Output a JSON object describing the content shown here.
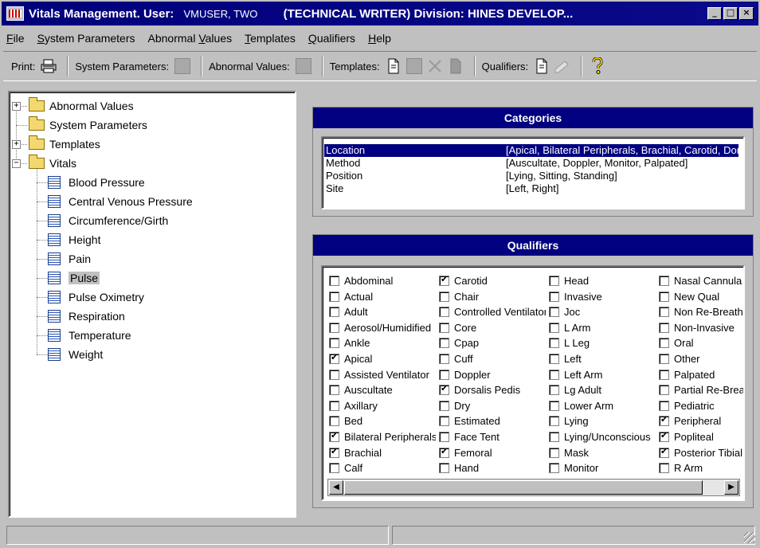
{
  "window": {
    "app": "Vitals Management.",
    "user_label": "User:",
    "user": "VMUSER, TWO",
    "division": "(TECHNICAL WRITER) Division: HINES DEVELOP..."
  },
  "menu": [
    {
      "pre": "",
      "u": "F",
      "post": "ile"
    },
    {
      "pre": "",
      "u": "S",
      "post": "ystem Parameters"
    },
    {
      "pre": "Abnormal ",
      "u": "V",
      "post": "alues"
    },
    {
      "pre": "",
      "u": "T",
      "post": "emplates"
    },
    {
      "pre": "",
      "u": "Q",
      "post": "ualifiers"
    },
    {
      "pre": "",
      "u": "H",
      "post": "elp"
    }
  ],
  "toolbar": {
    "print": "Print:",
    "system_parameters": "System Parameters:",
    "abnormal_values": "Abnormal Values:",
    "templates": "Templates:",
    "qualifiers": "Qualifiers:"
  },
  "tree": {
    "roots": [
      "Abnormal Values",
      "System Parameters",
      "Templates",
      "Vitals"
    ],
    "vitals": [
      "Blood Pressure",
      "Central Venous Pressure",
      "Circumference/Girth",
      "Height",
      "Pain",
      "Pulse",
      "Pulse Oximetry",
      "Respiration",
      "Temperature",
      "Weight"
    ],
    "selected": "Pulse"
  },
  "categories": {
    "title": "Categories",
    "rows": [
      {
        "name": "Location",
        "values": "[Apical, Bilateral Peripherals, Brachial, Carotid, Dorsalis Pedis"
      },
      {
        "name": "Method",
        "values": "[Auscultate, Doppler, Monitor, Palpated]"
      },
      {
        "name": "Position",
        "values": "[Lying, Sitting, Standing]"
      },
      {
        "name": "Site",
        "values": "[Left, Right]"
      }
    ],
    "selected": "Location"
  },
  "qualifiers": {
    "title": "Qualifiers",
    "columns": [
      [
        {
          "label": "Abdominal",
          "checked": false
        },
        {
          "label": "Actual",
          "checked": false
        },
        {
          "label": "Adult",
          "checked": false
        },
        {
          "label": "Aerosol/Humidified",
          "checked": false
        },
        {
          "label": "Ankle",
          "checked": false
        },
        {
          "label": "Apical",
          "checked": true
        },
        {
          "label": "Assisted Ventilator",
          "checked": false
        },
        {
          "label": "Auscultate",
          "checked": false
        },
        {
          "label": "Axillary",
          "checked": false
        },
        {
          "label": "Bed",
          "checked": false
        },
        {
          "label": "Bilateral Peripherals",
          "checked": true
        },
        {
          "label": "Brachial",
          "checked": true
        },
        {
          "label": "Calf",
          "checked": false
        }
      ],
      [
        {
          "label": "Carotid",
          "checked": true
        },
        {
          "label": "Chair",
          "checked": false
        },
        {
          "label": "Controlled Ventilator",
          "checked": false
        },
        {
          "label": "Core",
          "checked": false
        },
        {
          "label": "Cpap",
          "checked": false
        },
        {
          "label": "Cuff",
          "checked": false
        },
        {
          "label": "Doppler",
          "checked": false
        },
        {
          "label": "Dorsalis Pedis",
          "checked": true
        },
        {
          "label": "Dry",
          "checked": false
        },
        {
          "label": "Estimated",
          "checked": false
        },
        {
          "label": "Face Tent",
          "checked": false
        },
        {
          "label": "Femoral",
          "checked": true
        },
        {
          "label": "Hand",
          "checked": false
        }
      ],
      [
        {
          "label": "Head",
          "checked": false
        },
        {
          "label": "Invasive",
          "checked": false
        },
        {
          "label": "Joc",
          "checked": false
        },
        {
          "label": "L Arm",
          "checked": false
        },
        {
          "label": "L Leg",
          "checked": false
        },
        {
          "label": "Left",
          "checked": false
        },
        {
          "label": "Left Arm",
          "checked": false
        },
        {
          "label": "Lg Adult",
          "checked": false
        },
        {
          "label": "Lower Arm",
          "checked": false
        },
        {
          "label": "Lying",
          "checked": false
        },
        {
          "label": "Lying/Unconscious",
          "checked": false
        },
        {
          "label": "Mask",
          "checked": false
        },
        {
          "label": "Monitor",
          "checked": false
        }
      ],
      [
        {
          "label": "Nasal Cannula",
          "checked": false
        },
        {
          "label": "New Qual",
          "checked": false
        },
        {
          "label": "Non Re-Breathing",
          "checked": false
        },
        {
          "label": "Non-Invasive",
          "checked": false
        },
        {
          "label": "Oral",
          "checked": false
        },
        {
          "label": "Other",
          "checked": false
        },
        {
          "label": "Palpated",
          "checked": false
        },
        {
          "label": "Partial Re-Breathing",
          "checked": false
        },
        {
          "label": "Pediatric",
          "checked": false
        },
        {
          "label": "Peripheral",
          "checked": true
        },
        {
          "label": "Popliteal",
          "checked": true
        },
        {
          "label": "Posterior Tibial",
          "checked": true
        },
        {
          "label": "R Arm",
          "checked": false
        }
      ]
    ]
  },
  "status": {
    "panel1": "",
    "panel2": ""
  }
}
